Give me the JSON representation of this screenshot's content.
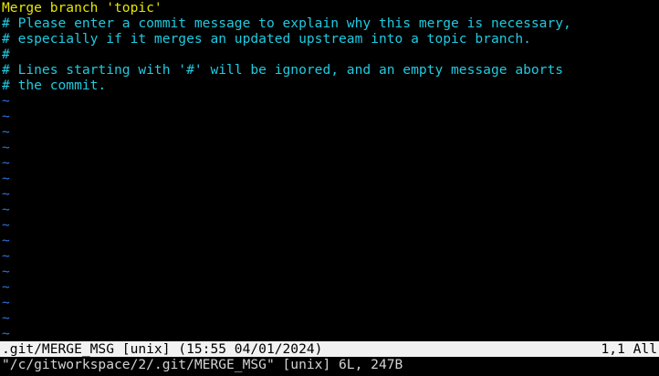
{
  "editor": {
    "lines": [
      {
        "text": "Merge branch 'topic'",
        "kind": "message"
      },
      {
        "text": "# Please enter a commit message to explain why this merge is necessary,",
        "kind": "comment"
      },
      {
        "text": "# especially if it merges an updated upstream into a topic branch.",
        "kind": "comment"
      },
      {
        "text": "#",
        "kind": "comment"
      },
      {
        "text": "# Lines starting with '#' will be ignored, and an empty message aborts",
        "kind": "comment"
      },
      {
        "text": "# the commit.",
        "kind": "comment"
      }
    ],
    "empty_line_marker": "~"
  },
  "status_bar": {
    "left": ".git/MERGE_MSG [unix] (15:55 04/01/2024)",
    "right": "1,1 All"
  },
  "command_line": {
    "text": "\"/c/gitworkspace/2/.git/MERGE_MSG\" [unix] 6L, 247B"
  },
  "colors": {
    "background": "#000000",
    "message_text": "#e6e600",
    "comment_text": "#1ecbe1",
    "tilde": "#2d74da",
    "status_bar_bg": "#f2f2f2",
    "status_bar_fg": "#000000"
  }
}
